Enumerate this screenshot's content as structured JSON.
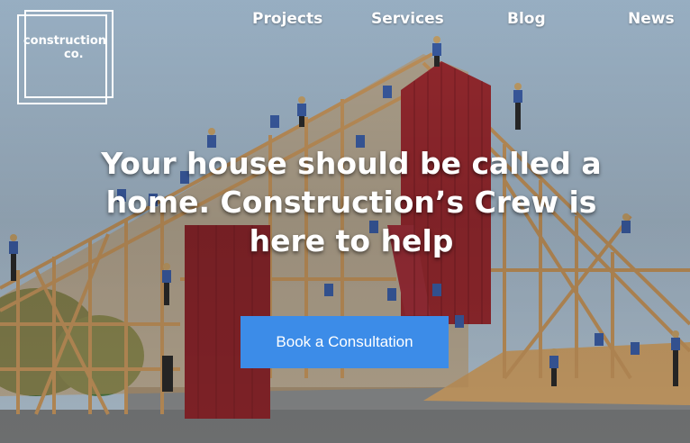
{
  "logo": {
    "line1": "construction",
    "line2": "co."
  },
  "nav": {
    "items": [
      "Projects",
      "Services",
      "Blog",
      "News"
    ]
  },
  "hero": {
    "headline": "Your house should be called a home. Construction’s Crew is here to help",
    "cta_label": "Book a Consultation"
  },
  "colors": {
    "cta_background": "#3c8ce8",
    "sky": "#a8bfd3",
    "barn_red": "#9b2a30",
    "timber": "#c9985e"
  }
}
